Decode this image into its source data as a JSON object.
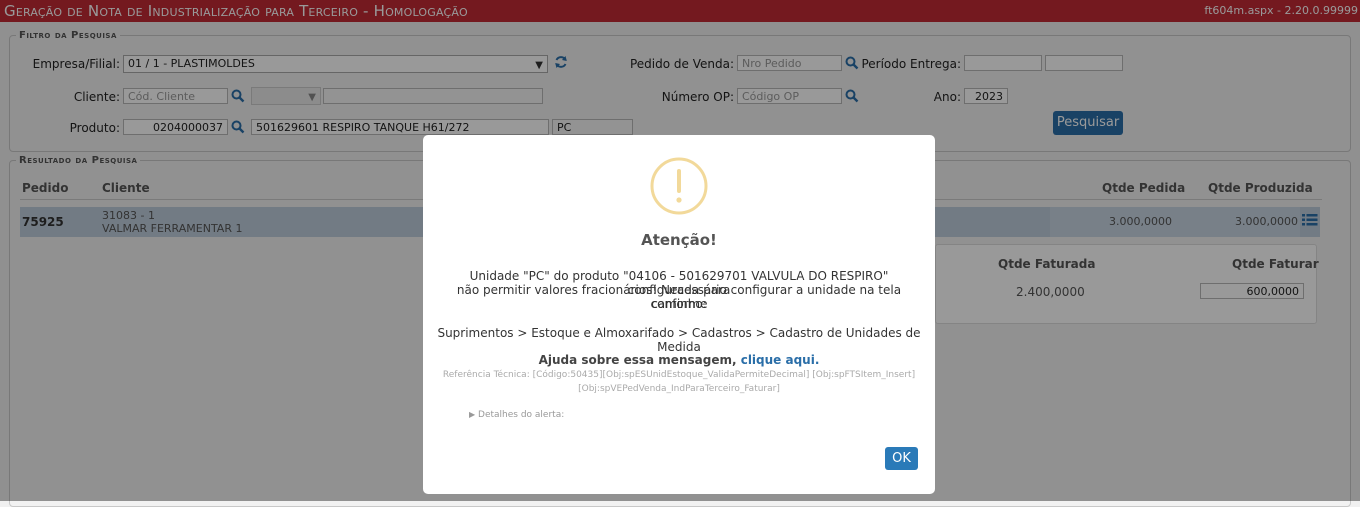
{
  "header": {
    "title": "Geração de Nota de Industrialização para Terceiro  - Homologação",
    "version": "ft604m.aspx - 2.20.0.99999"
  },
  "filter": {
    "legend": "Filtro da Pesquisa",
    "empresa_label": "Empresa/Filial:",
    "empresa_value": "01 / 1 - PLASTIMOLDES",
    "pedido_label": "Pedido de Venda:",
    "pedido_placeholder": "Nro Pedido",
    "periodo_label": "Período Entrega:",
    "cliente_label": "Cliente:",
    "cliente_placeholder": "Cód. Cliente",
    "numero_op_label": "Número OP:",
    "numero_op_placeholder": "Código OP",
    "ano_label": "Ano:",
    "ano_value": "2023",
    "produto_label": "Produto:",
    "produto_code": "0204000037",
    "produto_desc": "501629601 RESPIRO TANQUE H61/272",
    "produto_unit": "PC",
    "search_button": "Pesquisar"
  },
  "results": {
    "legend": "Resultado da Pesquisa",
    "columns": {
      "pedido": "Pedido",
      "cliente": "Cliente",
      "qtde_pedida": "Qtde Pedida",
      "qtde_produzida": "Qtde Produzida"
    },
    "row": {
      "pedido": "75925",
      "cliente_code": "31083 - 1",
      "cliente_name": "VALMAR FERRAMENTAR 1",
      "qtde_pedida": "3.000,0000",
      "qtde_produzida": "3.000,0000"
    },
    "sub": {
      "col_faturada": "Qtde Faturada",
      "col_faturar": "Qtde Faturar",
      "faturada": "2.400,0000",
      "faturar": "600,0000"
    }
  },
  "modal": {
    "title": "Atenção!",
    "message_1": "Unidade \"PC\" do produto \"04106 - 501629701 VALVULA DO RESPIRO\" configurada para",
    "message_2": "não permitir valores fracionários! Necessário configurar a unidade na tela conforme",
    "message_3": "caminho:",
    "path": "Suprimentos > Estoque e Almoxarifado > Cadastros > Cadastro de Unidades de Medida",
    "help_text": "Ajuda sobre essa mensagem,",
    "help_link": "clique aqui.",
    "ref_1": "Referência Técnica: [Código:50435][Obj:spESUnidEstoque_ValidaPermiteDecimal] [Obj:spFTSItem_Insert]",
    "ref_2": "[Obj:spVEPedVenda_IndParaTerceiro_Faturar]",
    "details": "Detalhes do alerta:",
    "ok": "OK"
  },
  "colors": {
    "title_bar": "#c22a35",
    "button_blue": "#2a6ea8",
    "row_selected": "#bfcedc",
    "warning": "#f2d99a"
  }
}
